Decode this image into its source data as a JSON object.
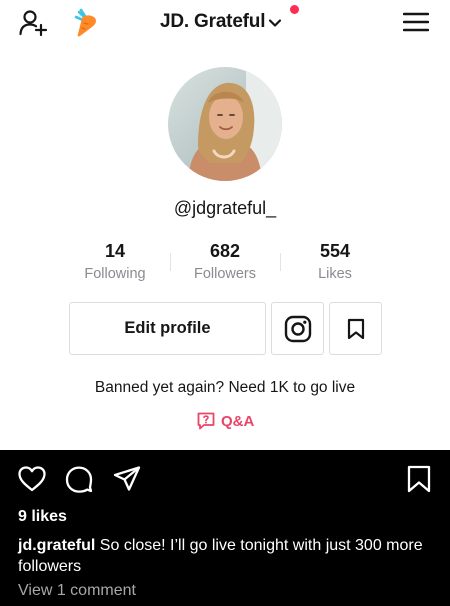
{
  "header": {
    "title": "JD. Grateful",
    "icons": {
      "left_1": "add-user-icon",
      "left_2": "carrot-icon",
      "title_chevron": "chevron-down-icon",
      "right": "hamburger-menu-icon"
    },
    "notification_dot_color": "#fe2c55"
  },
  "profile": {
    "handle": "@jdgrateful_",
    "stats": [
      {
        "value": "14",
        "label": "Following"
      },
      {
        "value": "682",
        "label": "Followers"
      },
      {
        "value": "554",
        "label": "Likes"
      }
    ],
    "edit_button_label": "Edit profile",
    "icon_buttons": [
      "instagram-icon",
      "bookmark-icon"
    ],
    "bio": "Banned yet again? Need 1K to go live",
    "qa_label": "Q&A",
    "accent_color": "#e8456a"
  },
  "post": {
    "action_icons": [
      "heart-icon",
      "comment-icon",
      "share-icon",
      "save-icon"
    ],
    "likes": "9 likes",
    "caption_user": "jd.grateful",
    "caption_text": "So close! I’ll go live tonight with just 300 more followers",
    "comments_link": "View 1 comment"
  }
}
